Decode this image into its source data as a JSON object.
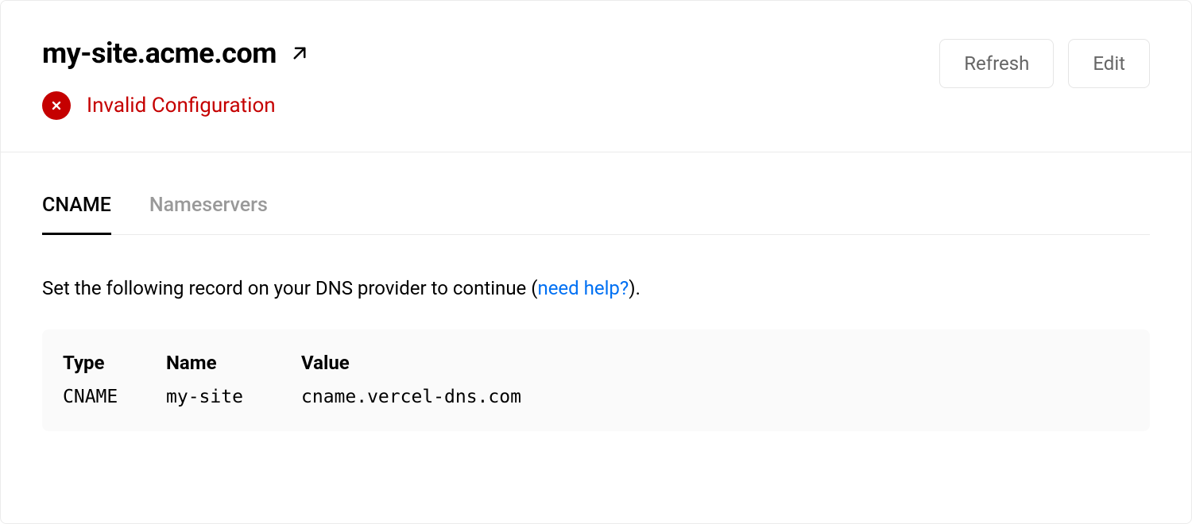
{
  "header": {
    "domain": "my-site.acme.com",
    "buttons": {
      "refresh": "Refresh",
      "edit": "Edit"
    },
    "status": "Invalid Configuration"
  },
  "tabs": [
    {
      "label": "CNAME",
      "active": true
    },
    {
      "label": "Nameservers",
      "active": false
    }
  ],
  "instruction": {
    "prefix": "Set the following record on your DNS provider to continue (",
    "help_link": "need help?",
    "suffix": ")."
  },
  "record": {
    "headers": {
      "type": "Type",
      "name": "Name",
      "value": "Value"
    },
    "row": {
      "type": "CNAME",
      "name": "my-site",
      "value": "cname.vercel-dns.com"
    }
  }
}
